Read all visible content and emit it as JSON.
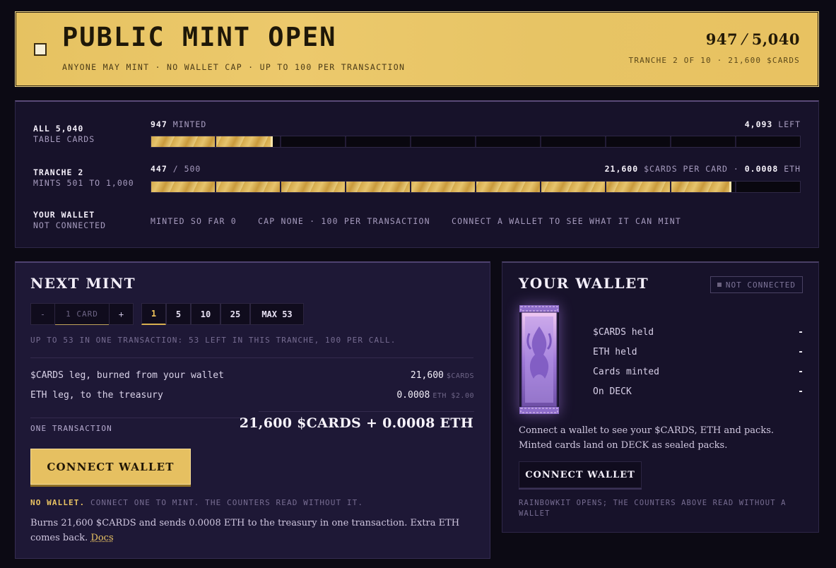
{
  "banner": {
    "title": "PUBLIC MINT OPEN",
    "subtitle": "ANYONE MAY MINT · NO WALLET CAP · UP TO 100 PER TRANSACTION",
    "count": "947 ⁄ 5,040",
    "tranche_line": "TRANCHE 2 OF 10 · 21,600 $CARDS"
  },
  "progress": {
    "all": {
      "label": "ALL 5,040",
      "sublabel": "TABLE CARDS",
      "minted_value": "947",
      "minted_label": "MINTED",
      "left_value": "4,093",
      "left_label": "LEFT",
      "fraction": 0.1879
    },
    "tranche": {
      "label": "TRANCHE 2",
      "sublabel": "MINTS 501 TO 1,000",
      "count_value": "447",
      "count_total": "/ 500",
      "price_value": "21,600",
      "price_label": "$CARDS PER CARD ·",
      "eth_value": "0.0008",
      "eth_label": "ETH",
      "fraction": 0.894
    },
    "wallet": {
      "label": "YOUR WALLET",
      "sublabel": "NOT CONNECTED",
      "minted": "MINTED SO FAR 0",
      "cap": "CAP NONE · 100 PER TRANSACTION",
      "hint": "CONNECT A WALLET TO SEE WHAT IT CAN MINT"
    }
  },
  "mint": {
    "heading": "NEXT MINT",
    "minus": "-",
    "qty_label": "1 CARD",
    "plus": "+",
    "presets": [
      "1",
      "5",
      "10",
      "25",
      "MAX 53"
    ],
    "hint": "UP TO 53 IN ONE TRANSACTION: 53 LEFT IN THIS TRANCHE, 100 PER CALL.",
    "cards_leg_label": "$CARDS leg, burned from your wallet",
    "cards_leg_value": "21,600",
    "cards_leg_unit": "$CARDS",
    "eth_leg_label": "ETH leg, to the treasury",
    "eth_leg_value": "0.0008",
    "eth_leg_unit": "ETH $2.00",
    "one_tx": "ONE TRANSACTION",
    "total": "21,600 $CARDS + 0.0008 ETH",
    "connect": "CONNECT WALLET",
    "no_wallet": "NO WALLET.",
    "no_wallet_rest": "CONNECT ONE TO MINT. THE COUNTERS READ WITHOUT IT.",
    "burns": "Burns 21,600 $CARDS and sends 0.0008 ETH to the treasury in one transaction. Extra ETH comes back.",
    "docs": "Docs"
  },
  "wallet": {
    "heading": "YOUR WALLET",
    "status": "NOT CONNECTED",
    "stats": [
      {
        "label": "$CARDS held",
        "value": "-"
      },
      {
        "label": "ETH held",
        "value": "-"
      },
      {
        "label": "Cards minted",
        "value": "-"
      },
      {
        "label": "On DECK",
        "value": "-"
      }
    ],
    "desc": "Connect a wallet to see your $CARDS, ETH and packs. Minted cards land on DECK as sealed packs.",
    "connect": "CONNECT WALLET",
    "rainbow": "RAINBOWKIT OPENS; THE COUNTERS ABOVE READ WITHOUT A WALLET"
  },
  "icons": {
    "checkbox": "checkbox-icon",
    "status_dot": "status-dot-icon",
    "pack": "card-pack-icon"
  },
  "colors": {
    "accent_gold": "#e6c061",
    "background": "#0c0a14",
    "panel": "#17122a"
  }
}
